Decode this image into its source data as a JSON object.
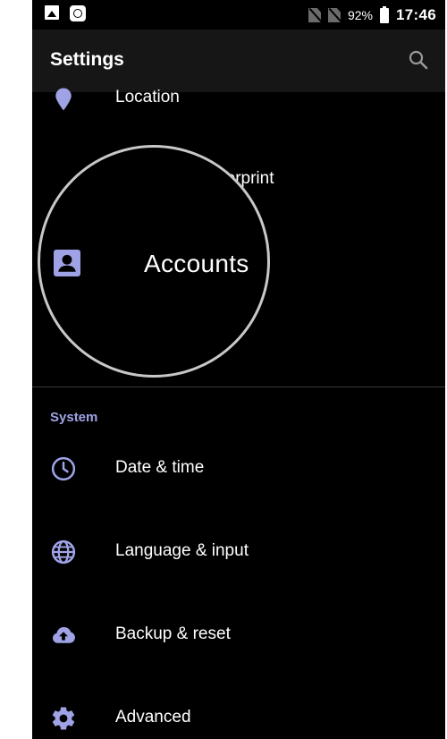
{
  "status_bar": {
    "battery": "92%",
    "time": "17:46"
  },
  "app_bar": {
    "title": "Settings"
  },
  "items": {
    "location": {
      "label": "Location",
      "icon": "location-pin-icon"
    },
    "fingerprint": {
      "label": "fingerprint",
      "icon": "fingerprint-icon"
    },
    "accounts": {
      "label": "Accounts",
      "icon": "account-box-icon"
    }
  },
  "system": {
    "header": "System",
    "items": [
      {
        "label": "Date & time",
        "icon": "clock-icon"
      },
      {
        "label": "Language & input",
        "icon": "globe-icon"
      },
      {
        "label": "Backup & reset",
        "icon": "cloud-upload-icon"
      },
      {
        "label": "Advanced",
        "icon": "gear-icon"
      }
    ]
  },
  "colors": {
    "accent": "#9fa3e6",
    "background": "#000000",
    "app_bar": "#161616"
  }
}
